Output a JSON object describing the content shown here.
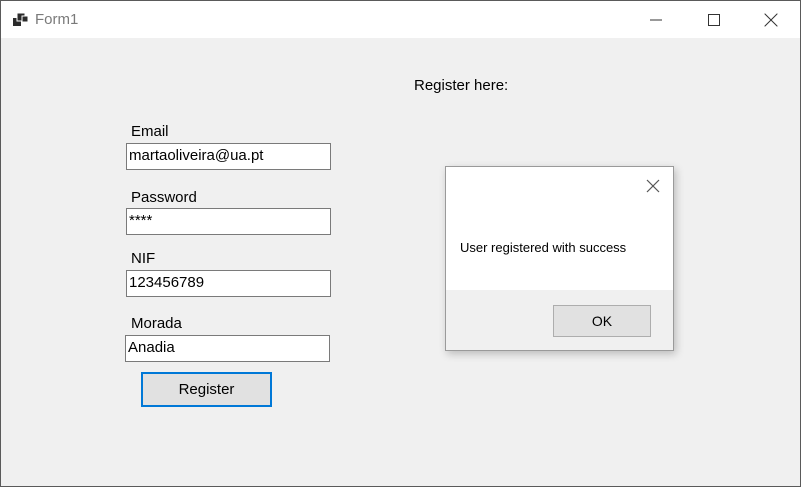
{
  "window": {
    "title": "Form1",
    "icons": {
      "app": "windows-form-icon",
      "minimize": "minimize-icon",
      "maximize": "maximize-icon",
      "close": "close-icon"
    }
  },
  "form": {
    "heading": "Register here:",
    "email": {
      "label": "Email",
      "value": "martaoliveira@ua.pt"
    },
    "password": {
      "label": "Password",
      "value": "****"
    },
    "nif": {
      "label": "NIF",
      "value": "123456789"
    },
    "morada": {
      "label": "Morada",
      "value": "Anadia"
    },
    "register_label": "Register"
  },
  "dialog": {
    "message": "User registered with success",
    "ok_label": "OK"
  },
  "colors": {
    "background": "#f0f0f0",
    "titlebar": "#ffffff",
    "focus_accent": "#0078d7",
    "button_face": "#e1e1e1"
  }
}
